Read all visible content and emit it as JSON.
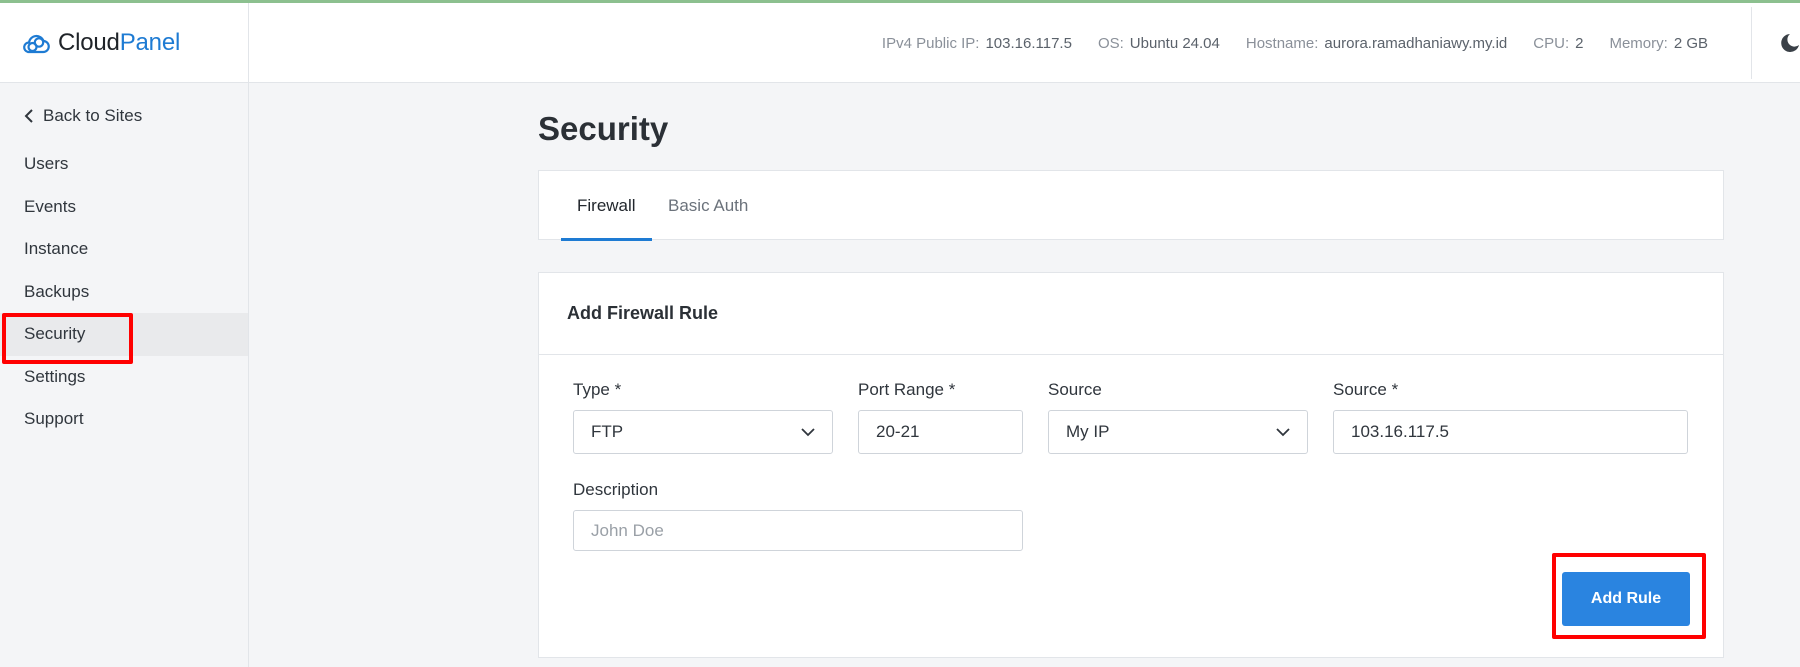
{
  "brand": {
    "part1": "Cloud",
    "part2": "Panel"
  },
  "sysinfo": [
    {
      "label": "IPv4 Public IP:",
      "value": "103.16.117.5"
    },
    {
      "label": "OS:",
      "value": "Ubuntu 24.04"
    },
    {
      "label": "Hostname:",
      "value": "aurora.ramadhaniawy.my.id"
    },
    {
      "label": "CPU:",
      "value": "2"
    },
    {
      "label": "Memory:",
      "value": "2 GB"
    }
  ],
  "sidebar": {
    "back_label": "Back to Sites",
    "items": [
      {
        "label": "Users"
      },
      {
        "label": "Events"
      },
      {
        "label": "Instance"
      },
      {
        "label": "Backups"
      },
      {
        "label": "Security",
        "active": true
      },
      {
        "label": "Settings"
      },
      {
        "label": "Support"
      }
    ]
  },
  "page": {
    "title": "Security"
  },
  "tabs": [
    {
      "label": "Firewall",
      "active": true
    },
    {
      "label": "Basic Auth"
    }
  ],
  "form": {
    "title": "Add Firewall Rule",
    "type": {
      "label": "Type *",
      "value": "FTP"
    },
    "port_range": {
      "label": "Port Range *",
      "value": "20-21"
    },
    "source_select": {
      "label": "Source",
      "value": "My IP"
    },
    "source_input": {
      "label": "Source *",
      "value": "103.16.117.5"
    },
    "description": {
      "label": "Description",
      "placeholder": "John Doe"
    },
    "submit_label": "Add Rule"
  },
  "colors": {
    "accent": "#1e7bd3",
    "button": "#2a84e0",
    "highlight": "#ff0000"
  }
}
